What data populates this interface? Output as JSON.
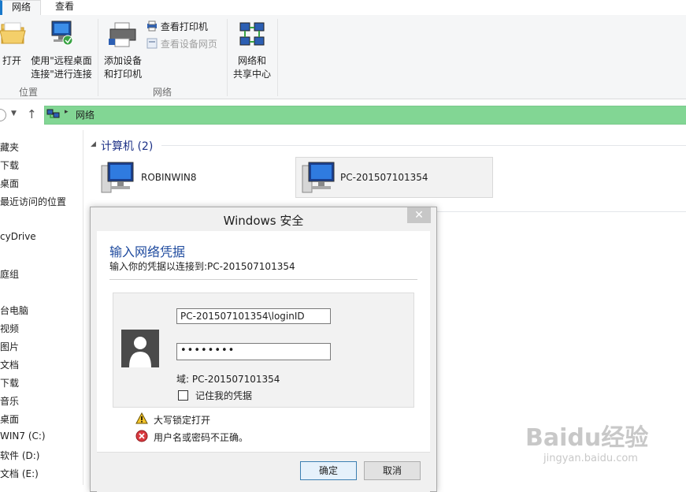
{
  "ribbon": {
    "tabs": [
      "网络",
      "查看"
    ],
    "buttons": {
      "open": "打开",
      "remote_line1": "使用\"远程桌面",
      "remote_line2": "连接\"进行连接",
      "add_line1": "添加设备",
      "add_line2": "和打印机",
      "view_printers": "查看打印机",
      "view_device_page": "查看设备网页",
      "center_line1": "网络和",
      "center_line2": "共享中心"
    },
    "groups": [
      "位置",
      "网络"
    ]
  },
  "address": {
    "path": "网络"
  },
  "sidebar": {
    "items": [
      "藏夹",
      "下载",
      "桌面",
      "最近访问的位置",
      "cyDrive",
      "庭组",
      "台电脑",
      "视频",
      "图片",
      "文档",
      "下载",
      "音乐",
      "桌面",
      "WIN7 (C:)",
      "软件 (D:)",
      "文档 (E:)"
    ]
  },
  "content": {
    "section_title": "计算机 (2)",
    "computers": [
      "ROBINWIN8",
      "PC-201507101354"
    ]
  },
  "dialog": {
    "title": "Windows 安全",
    "close": "✕",
    "heading": "输入网络凭据",
    "subtitle": "输入你的凭据以连接到:PC-201507101354",
    "username": "PC-201507101354\\loginID",
    "password": "••••••••",
    "domain": "域: PC-201507101354",
    "remember": "记住我的凭据",
    "warning": "大写锁定打开",
    "error": "用户名或密码不正确。",
    "ok": "确定",
    "cancel": "取消"
  },
  "watermark": {
    "brand": "Baidu经验",
    "url": "jingyan.baidu.com"
  }
}
